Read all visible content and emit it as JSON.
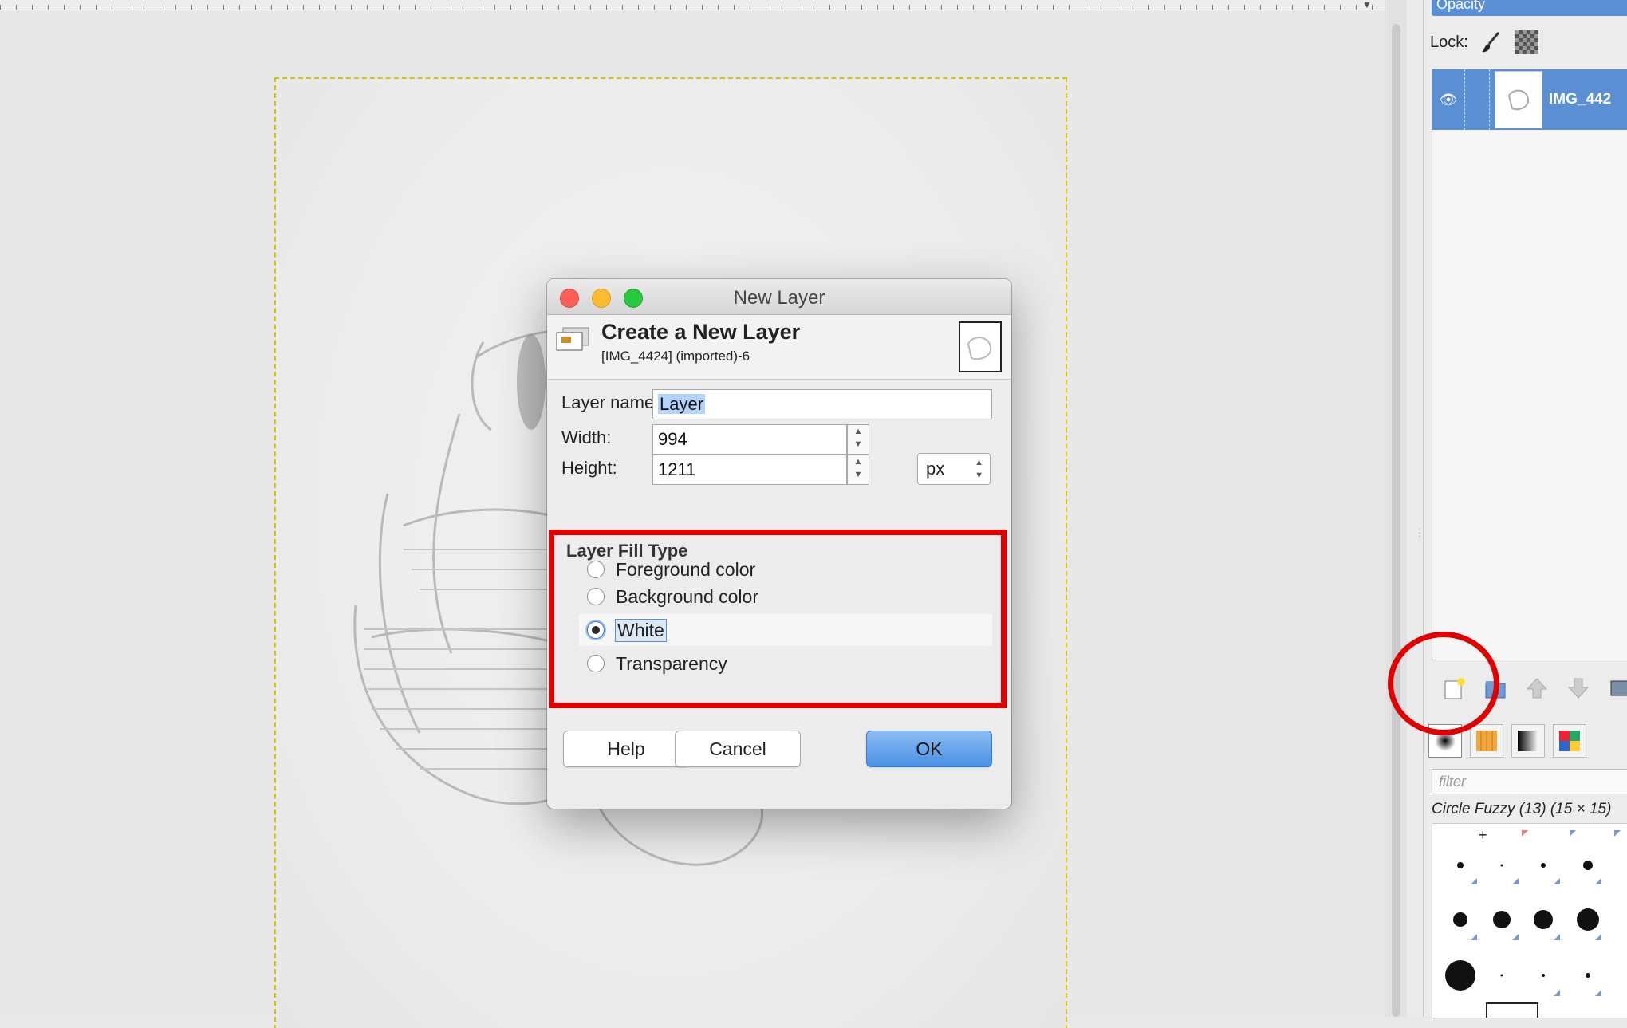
{
  "dialog": {
    "window_title": "New Layer",
    "header_title": "Create a New Layer",
    "header_subtitle": "[IMG_4424] (imported)-6",
    "layer_name_label": "Layer name:",
    "layer_name_value": "Layer",
    "width_label": "Width:",
    "width_value": "994",
    "height_label": "Height:",
    "height_value": "1211",
    "unit": "px",
    "fill_type_title": "Layer Fill Type",
    "fill_options": [
      "Foreground color",
      "Background color",
      "White",
      "Transparency"
    ],
    "selected_fill": "White",
    "buttons": {
      "help": "Help",
      "cancel": "Cancel",
      "ok": "OK"
    }
  },
  "dock": {
    "opacity_label": "Opacity",
    "lock_label": "Lock:",
    "layer_name": "IMG_442",
    "filter_placeholder": "filter",
    "brush_name": "Circle Fuzzy (13) (15 × 15)"
  },
  "colors": {
    "accent": "#5a8fd3",
    "annotation_red": "#e00000",
    "ok_button": "#4a91e6"
  }
}
